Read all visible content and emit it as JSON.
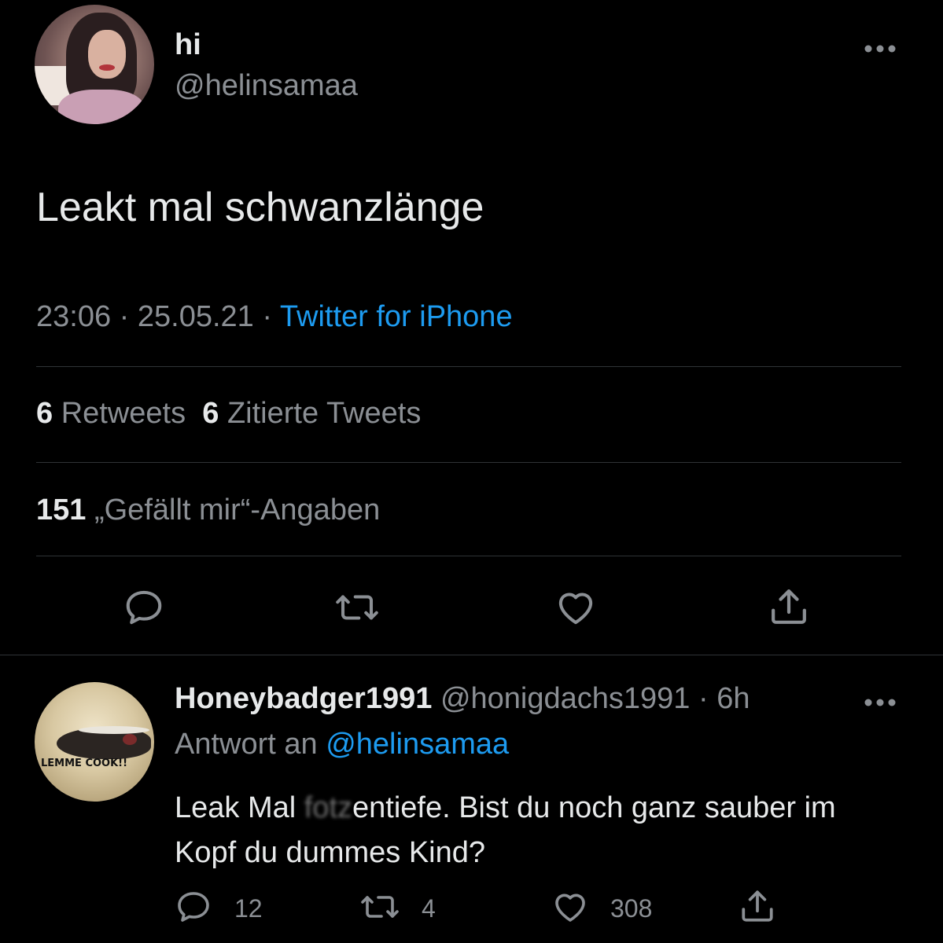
{
  "tweet": {
    "display_name": "hi",
    "handle": "@helinsamaa",
    "text": "Leakt mal schwanzlänge",
    "time": "23:06",
    "date": "25.05.21",
    "separator": " · ",
    "source": "Twitter for iPhone",
    "retweets_count": "6",
    "retweets_label": "Retweets",
    "quotes_count": "6",
    "quotes_label": "Zitierte Tweets",
    "likes_count": "151",
    "likes_label": "„Gefällt mir“-Angaben",
    "more_icon": "more-icon"
  },
  "actions": {
    "icons": [
      "reply-icon",
      "retweet-icon",
      "like-icon",
      "share-icon"
    ]
  },
  "reply": {
    "display_name": "Honeybadger1991",
    "handle": "@honigdachs1991",
    "separator": " · ",
    "time_ago": "6h",
    "reply_to_label": "Antwort an ",
    "reply_to_handle": "@helinsamaa",
    "text_before": "Leak Mal ",
    "text_censored": "fotz",
    "text_after": "entiefe. Bist du noch ganz sauber im Kopf du dummes Kind?",
    "avatar_caption": "LEMME COOK!!",
    "reply_count": "12",
    "retweet_count": "4",
    "like_count": "308"
  },
  "colors": {
    "background": "#000000",
    "text": "#e7e9ea",
    "secondary": "#8b8f94",
    "accent": "#1d9bf0",
    "divider": "#2f3336"
  }
}
